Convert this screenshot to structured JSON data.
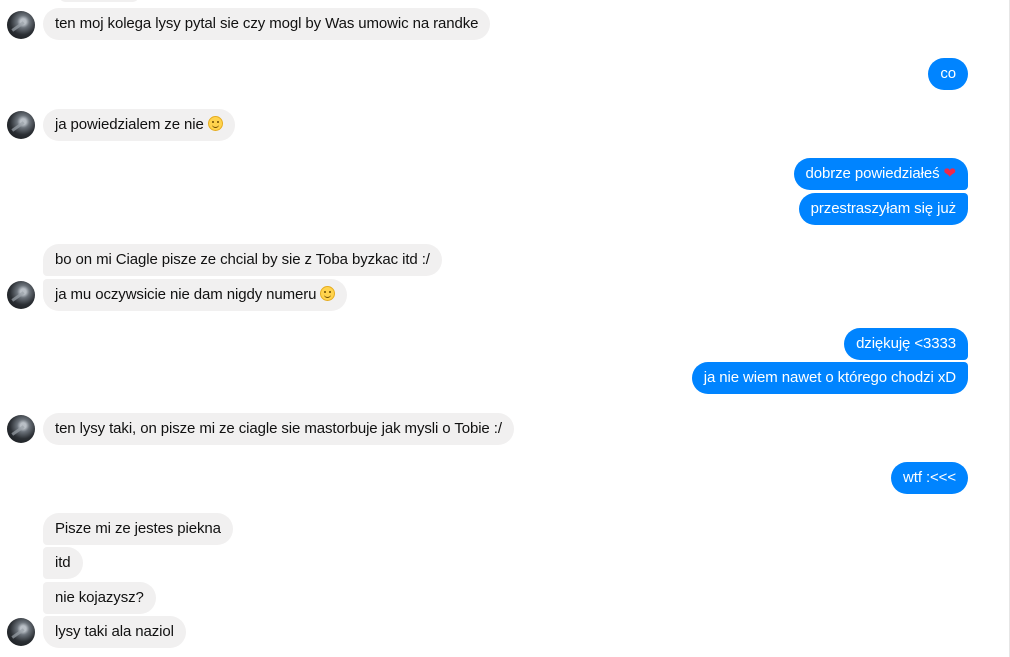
{
  "messages": [
    {
      "text": "ten moj kolega lysy pytal sie czy mogl by Was umowic na randke"
    },
    {
      "text": "co"
    },
    {
      "text": "ja powiedzialem ze nie",
      "icon": "smiley-emoji"
    },
    {
      "text": "dobrze powiedziałeś",
      "icon": "heart-emoji"
    },
    {
      "text": "przestraszyłam się już"
    },
    {
      "text": "bo on mi Ciagle pisze ze chcial by sie z Toba byzkac itd :/"
    },
    {
      "text": "ja mu oczywsicie nie dam nigdy numeru",
      "icon": "smiley-emoji"
    },
    {
      "text": "dziękuję <3333"
    },
    {
      "text": "ja nie wiem nawet o którego chodzi xD"
    },
    {
      "text": "ten lysy taki, on pisze mi ze ciagle sie mastorbuje jak mysli o Tobie :/"
    },
    {
      "text": "wtf :<<<"
    },
    {
      "text": "Pisze mi ze jestes piekna"
    },
    {
      "text": "itd"
    },
    {
      "text": "nie kojazysz?"
    },
    {
      "text": "lysy taki ala naziol"
    }
  ],
  "colors": {
    "outgoing_bubble": "#0084ff",
    "incoming_bubble": "#f1f0f0",
    "heart": "#f02849"
  }
}
